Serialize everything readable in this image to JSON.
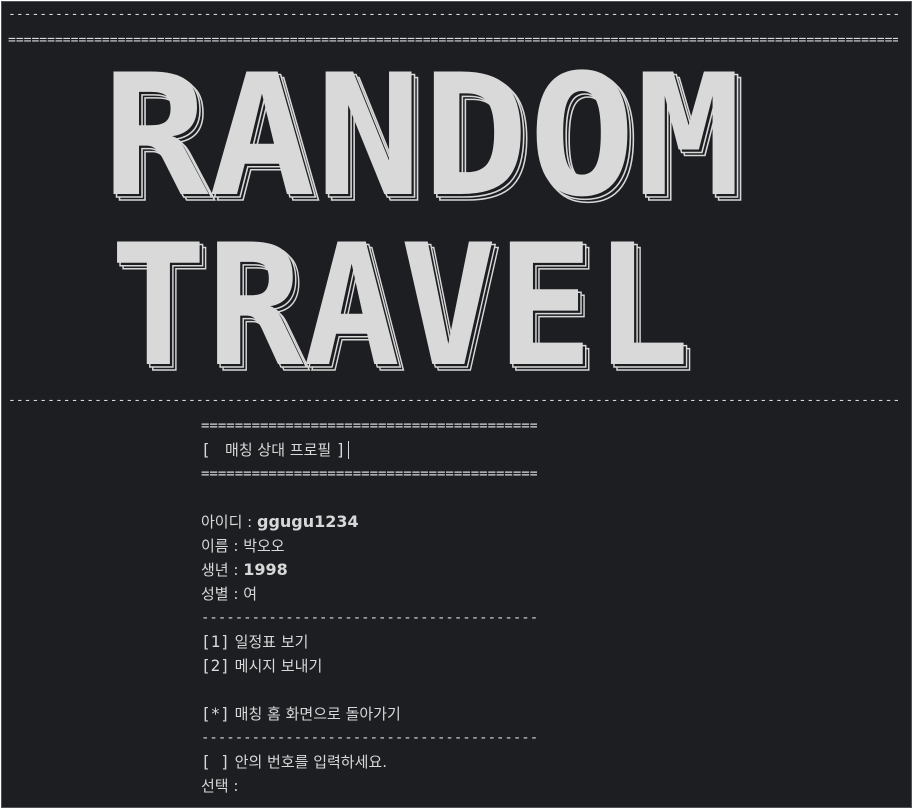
{
  "logo": {
    "line1": "RANDOM",
    "line2": "TRAVEL"
  },
  "rules": {
    "dash": "-----------------------------------------------------------------------------------------------------------------------------------------------------",
    "equals": "=====================================================================================================================================================",
    "short_equals": "==============================================",
    "short_dash": "----------------------------------------------"
  },
  "profile": {
    "header_open": "[ ",
    "header_title": " 매칭 상대 프로필 ",
    "header_close": "]",
    "id_label": "아이디 : ",
    "id_value": "ggugu1234",
    "name_label": "이름 : ",
    "name_value": "박오오",
    "birth_label": "생년 : ",
    "birth_value": "1998",
    "gender_label": "성별 : ",
    "gender_value": "여"
  },
  "menu": {
    "opt1_key": "[1]",
    "opt1_label": " 일정표 보기",
    "opt2_key": "[2]",
    "opt2_label": " 메시지 보내기",
    "back_key": "[*]",
    "back_label": " 매칭 홈 화면으로 돌아가기"
  },
  "prompt": {
    "hint_key": "[ ]",
    "hint_text": " 안의 번호를 입력하세요.",
    "select_label": "선택 : "
  },
  "colors": {
    "background": "#1c1e21",
    "text": "#d8d8d8",
    "logo_fill": "#d9d9d9"
  }
}
